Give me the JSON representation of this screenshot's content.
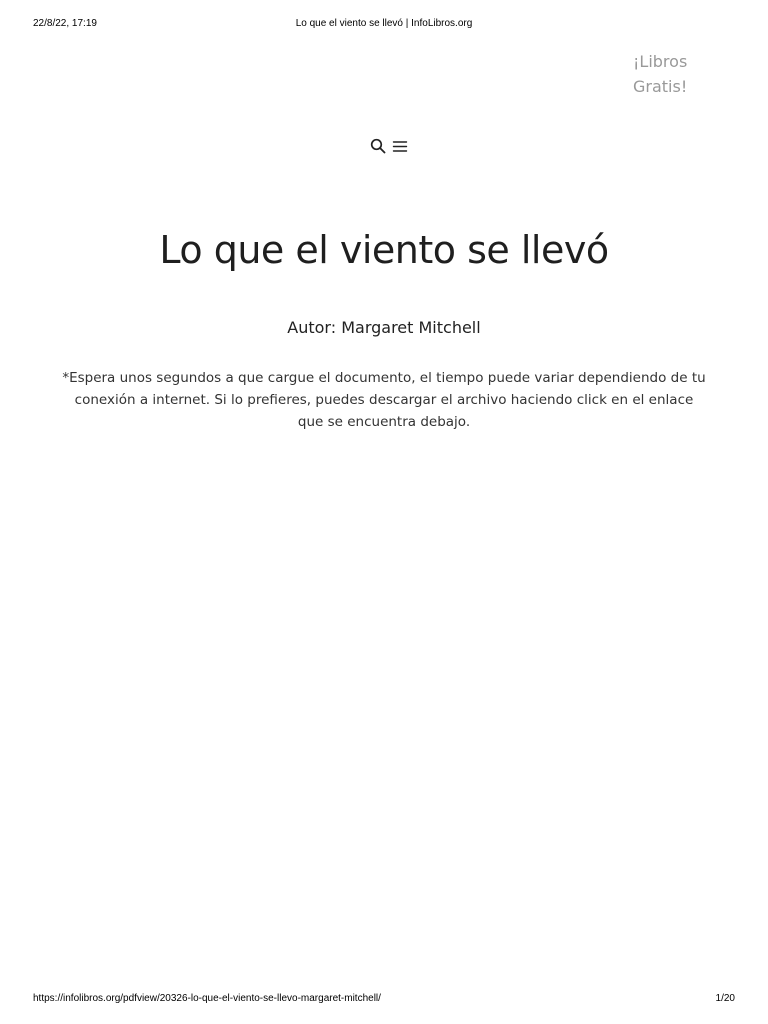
{
  "print_header": {
    "datetime": "22/8/22, 17:19",
    "title": "Lo que el viento se llevó | InfoLibros.org"
  },
  "header": {
    "brand_line1": "¡Libros",
    "brand_line2": "Gratis!",
    "icons": [
      "search-icon",
      "menu-icon"
    ]
  },
  "main": {
    "title": "Lo que el viento se llevó",
    "author": "Autor: Margaret Mitchell",
    "note": "*Espera unos segundos a que cargue el documento, el tiempo puede variar dependiendo de tu conexión a internet. Si lo prefieres, puedes descargar el archivo haciendo click en el enlace que se encuentra debajo."
  },
  "print_footer": {
    "url": "https://infolibros.org/pdfview/20326-lo-que-el-viento-se-llevo-margaret-mitchell/",
    "page": "1/20"
  }
}
